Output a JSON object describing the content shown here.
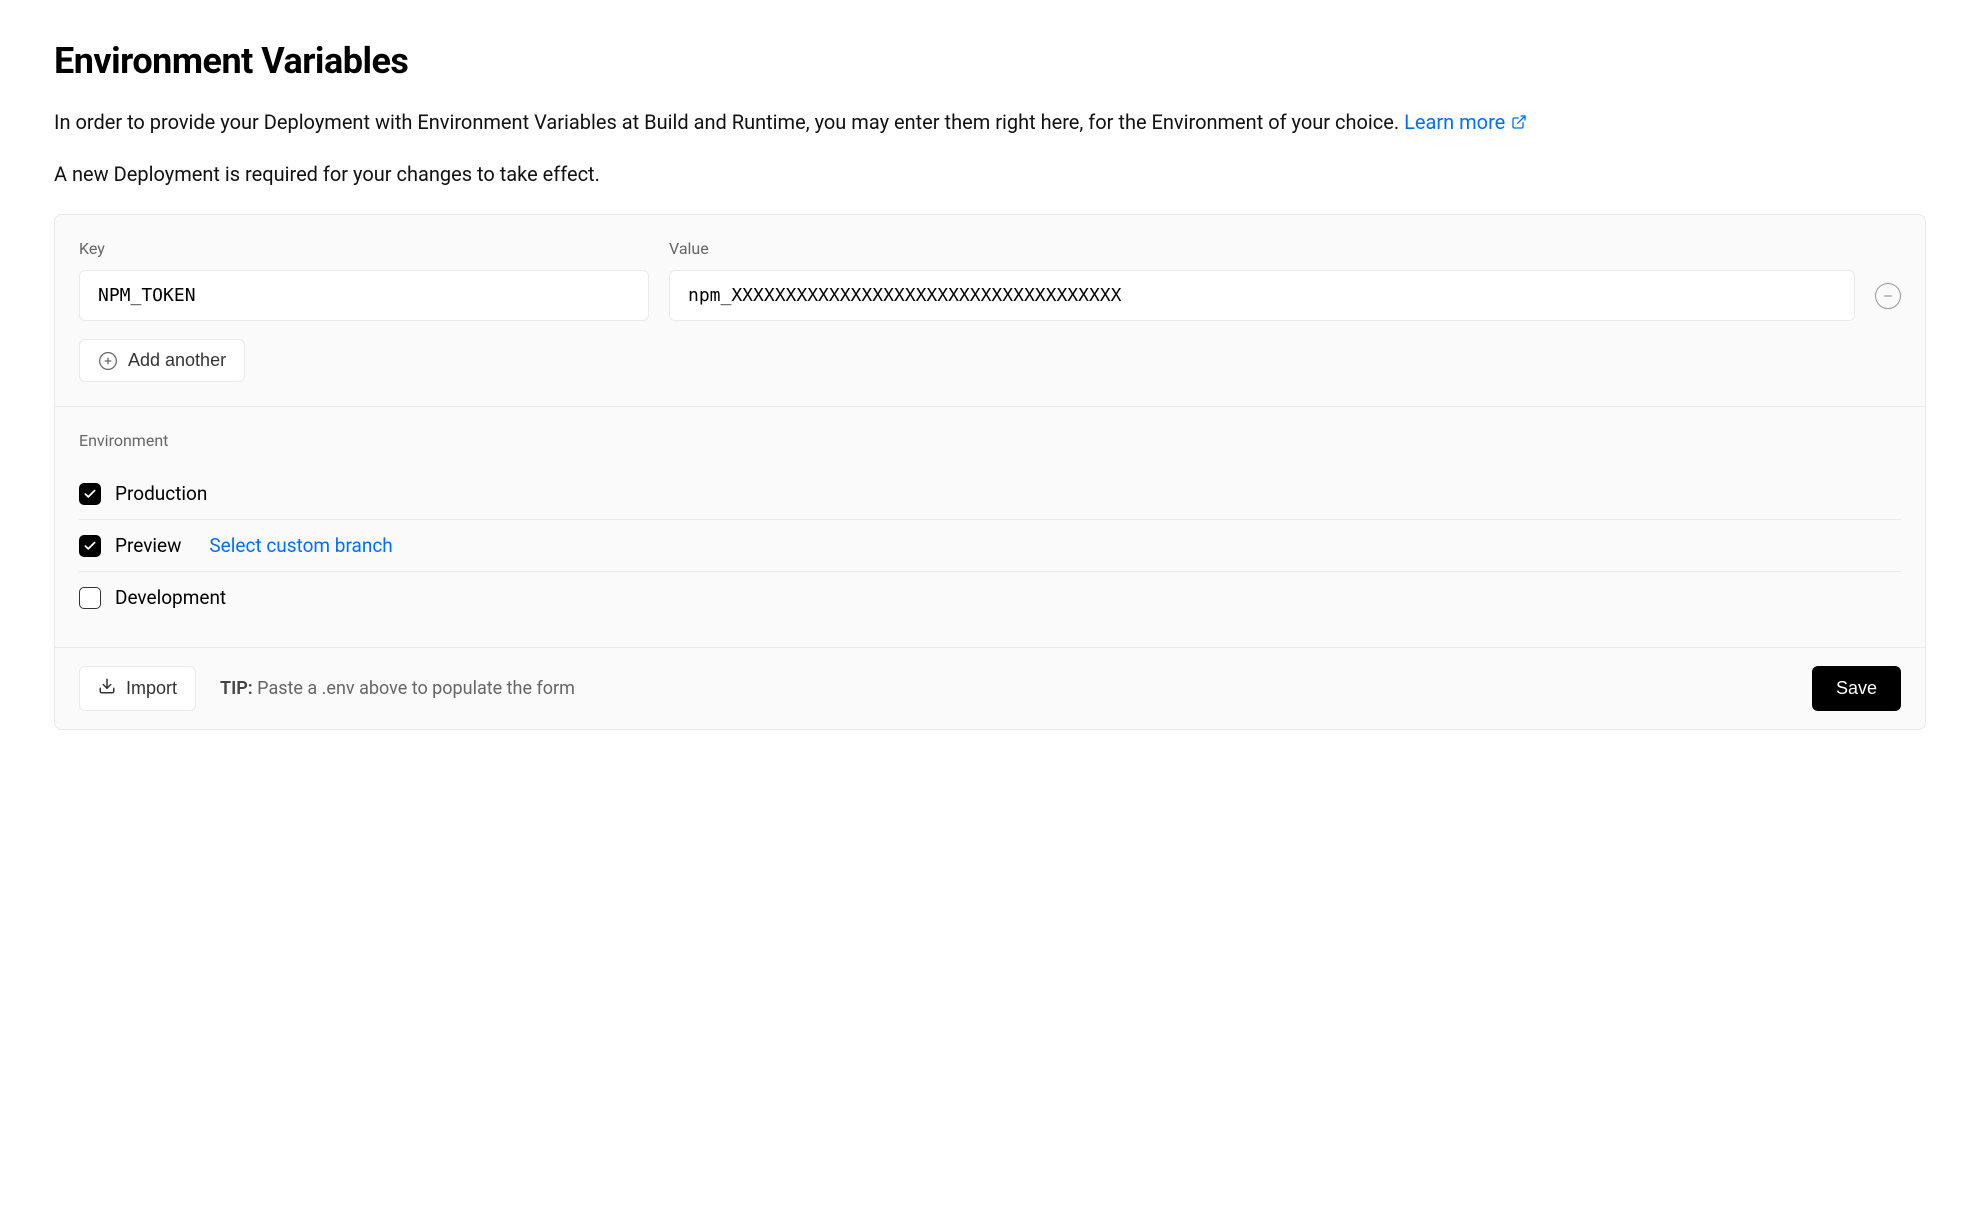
{
  "title": "Environment Variables",
  "description": "In order to provide your Deployment with Environment Variables at Build and Runtime, you may enter them right here, for the Environment of your choice. ",
  "learn_more": "Learn more",
  "note": "A new Deployment is required for your changes to take effect.",
  "labels": {
    "key": "Key",
    "value": "Value",
    "environment": "Environment"
  },
  "row": {
    "key": "NPM_TOKEN",
    "value": "npm_XXXXXXXXXXXXXXXXXXXXXXXXXXXXXXXXXXXX"
  },
  "add_another": "Add another",
  "environments": {
    "production": {
      "label": "Production",
      "checked": true
    },
    "preview": {
      "label": "Preview",
      "checked": true,
      "branch_link": "Select custom branch"
    },
    "development": {
      "label": "Development",
      "checked": false
    }
  },
  "footer": {
    "import": "Import",
    "tip_label": "TIP:",
    "tip_text": " Paste a .env above to populate the form",
    "save": "Save"
  }
}
